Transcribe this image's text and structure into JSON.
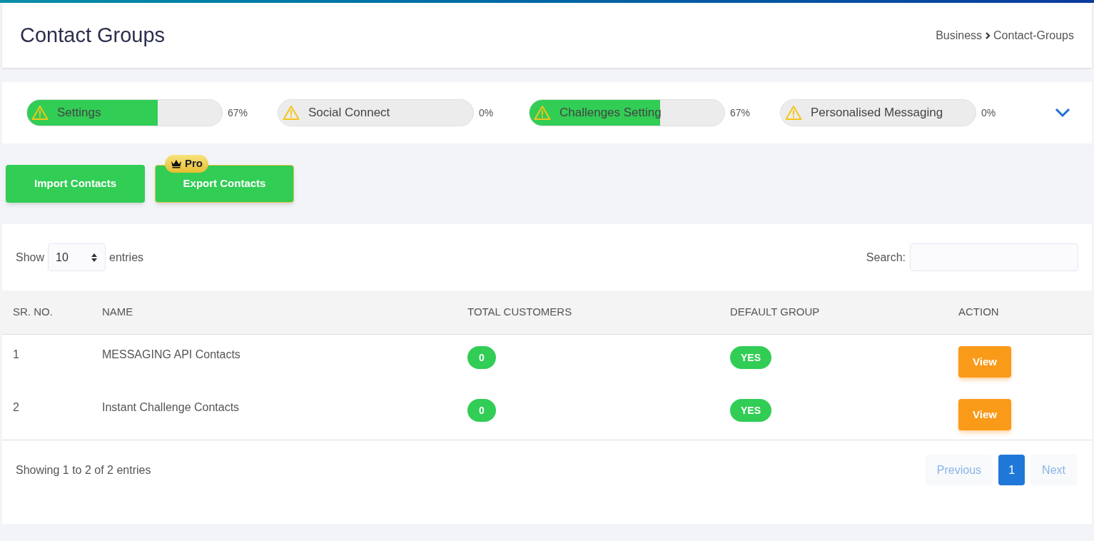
{
  "header": {
    "title": "Contact Groups",
    "breadcrumb": [
      "Business",
      "Contact-Groups"
    ]
  },
  "progress": [
    {
      "label": "Settings",
      "level": 0.67,
      "reading": "67%"
    },
    {
      "label": "Social Connect",
      "level": 0,
      "reading": "0%"
    },
    {
      "label": "Challenges Setting",
      "level": 0.67,
      "reading": "67%"
    },
    {
      "label": "Personalised Messaging",
      "level": 0,
      "reading": "0%"
    }
  ],
  "actions": [
    {
      "label": "Import Contacts"
    },
    {
      "label": "Export Contacts",
      "badge": "Pro"
    }
  ],
  "table_controls": {
    "show_label": "Show",
    "page_size": "10",
    "entries_label": "entries",
    "search_label": "Search:"
  },
  "table": {
    "columns": [
      "SR. NO.",
      "NAME",
      "TOTAL CUSTOMERS",
      "DEFAULT GROUP",
      "ACTION"
    ],
    "rows": [
      {
        "sr": "1",
        "name": "MESSAGING API Contacts",
        "total": "0",
        "default": "YES",
        "action": "View"
      },
      {
        "sr": "2",
        "name": "Instant Challenge Contacts",
        "total": "0",
        "default": "YES",
        "action": "View"
      }
    ]
  },
  "footer": {
    "info": "Showing 1 to 2 of 2 entries",
    "pagination": [
      {
        "label": "Previous",
        "kind": "nav",
        "disabled": true,
        "selected": false
      },
      {
        "label": "1",
        "kind": "page",
        "disabled": false,
        "selected": true
      },
      {
        "label": "Next",
        "kind": "nav",
        "disabled": true,
        "selected": false
      }
    ]
  }
}
